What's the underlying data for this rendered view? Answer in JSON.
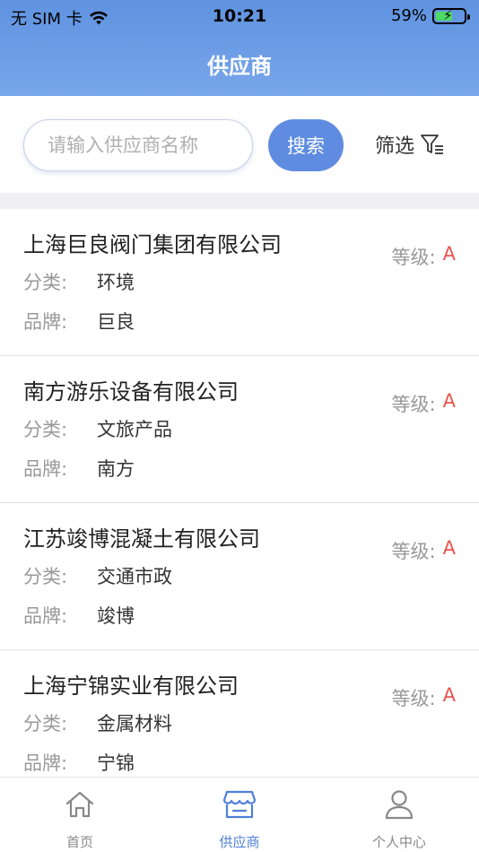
{
  "status_bar": {
    "carrier": "无 SIM 卡",
    "time": "10:21",
    "battery_percent": "59%",
    "battery_level": 0.59,
    "icons": [
      "wifi-icon",
      "battery-charging-icon"
    ]
  },
  "header": {
    "title": "供应商"
  },
  "search": {
    "placeholder": "请输入供应商名称",
    "button_label": "搜索",
    "filter_label": "筛选",
    "filter_icon": "funnel-icon"
  },
  "colors": {
    "accent": "#5f8ce0",
    "grade": "#e8544d",
    "tab_active": "#4f7fd9"
  },
  "suppliers": [
    {
      "name": "上海巨良阀门集团有限公司",
      "category_label": "分类:",
      "category": "环境",
      "brand_label": "品牌:",
      "brand": "巨良",
      "grade_label": "等级:",
      "grade": "A"
    },
    {
      "name": "南方游乐设备有限公司",
      "category_label": "分类:",
      "category": "文旅产品",
      "brand_label": "品牌:",
      "brand": "南方",
      "grade_label": "等级:",
      "grade": "A"
    },
    {
      "name": "江苏竣博混凝土有限公司",
      "category_label": "分类:",
      "category": "交通市政",
      "brand_label": "品牌:",
      "brand": "竣博",
      "grade_label": "等级:",
      "grade": "A"
    },
    {
      "name": "上海宁锦实业有限公司",
      "category_label": "分类:",
      "category": "金属材料",
      "brand_label": "品牌:",
      "brand": "宁锦",
      "grade_label": "等级:",
      "grade": "A"
    }
  ],
  "tabbar": {
    "items": [
      {
        "label": "首页",
        "icon": "home-icon",
        "active": false
      },
      {
        "label": "供应商",
        "icon": "store-icon",
        "active": true
      },
      {
        "label": "个人中心",
        "icon": "user-icon",
        "active": false
      }
    ]
  }
}
